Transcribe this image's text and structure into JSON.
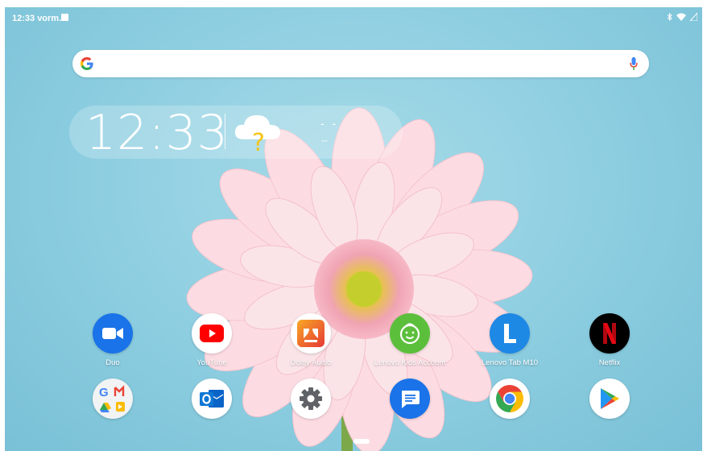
{
  "status_bar": {
    "time": "12:33 vorm.",
    "icons": [
      "image-icon",
      "bluetooth-icon",
      "wifi-icon",
      "signal-icon"
    ]
  },
  "search": {
    "logo": "G",
    "icon_mic": "mic-icon"
  },
  "clock": {
    "time": "12:33",
    "weather_symbol": "?",
    "weather_temp": "- -",
    "weather_location": "--"
  },
  "apps_row1": [
    {
      "label": "Duo",
      "icon": "video-camera-icon",
      "bg": "#1a73e8"
    },
    {
      "label": "YouTube",
      "icon": "youtube-play-icon",
      "bg": "#ffffff"
    },
    {
      "label": "Dolby Audio",
      "icon": "dolby-icon",
      "bg": "#ffffff"
    },
    {
      "label": "Lenovo Kids Account",
      "icon": "kid-face-icon",
      "bg": "#5cbf3c"
    },
    {
      "label": "Lenovo Tab M10",
      "icon": "letter-l-icon",
      "bg": "#1e88e5"
    },
    {
      "label": "Netflix",
      "icon": "netflix-icon",
      "bg": "#000000"
    }
  ],
  "apps_row2": [
    {
      "icon": "google-folder-icon",
      "bg": "#f1f3f4"
    },
    {
      "icon": "outlook-icon",
      "bg": "#ffffff"
    },
    {
      "icon": "settings-gear-icon",
      "bg": "#ffffff"
    },
    {
      "icon": "messages-icon",
      "bg": "#1a73e8"
    },
    {
      "icon": "chrome-icon",
      "bg": "#ffffff"
    },
    {
      "icon": "play-store-icon",
      "bg": "#ffffff"
    }
  ],
  "colors": {
    "background": "#8ccde0",
    "duo": "#1a73e8",
    "youtube_red": "#ff0000",
    "kids_green": "#5cbf3c",
    "lenovo_blue": "#1e88e5",
    "netflix_red": "#e50914"
  }
}
